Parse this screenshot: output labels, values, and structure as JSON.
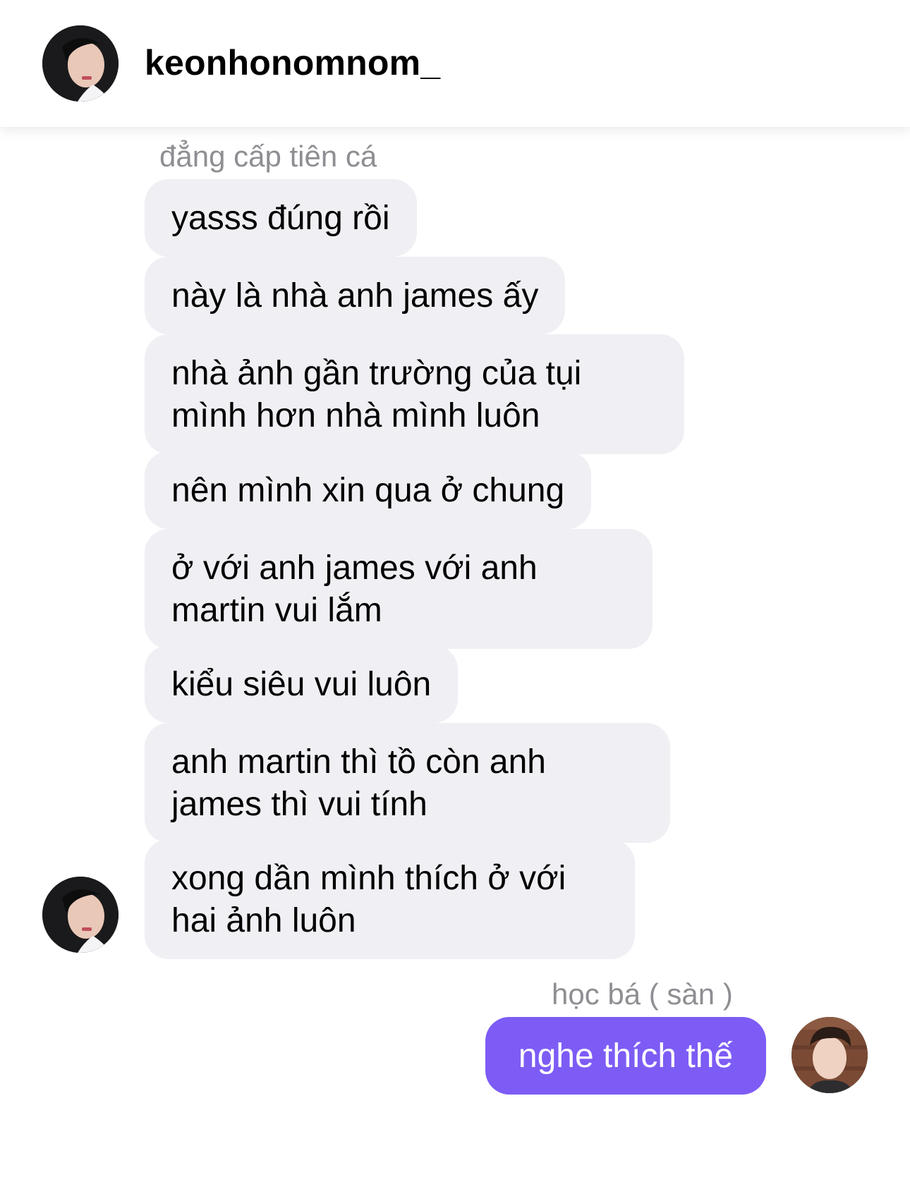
{
  "header": {
    "username": "keonhonomnom_",
    "avatar_icon": "profile-photo-avatar"
  },
  "incoming": {
    "sender_label": "đẳng cấp tiên cá",
    "messages": [
      "yasss đúng rồi",
      "này là nhà anh james ấy",
      "nhà ảnh gần trường của tụi mình hơn nhà mình luôn",
      "nên mình xin qua ở chung",
      "ở với anh james với anh martin vui lắm",
      "kiểu siêu vui luôn",
      "anh martin thì tồ còn anh james thì vui tính",
      "xong dần mình thích ở với hai ảnh luôn"
    ]
  },
  "outgoing": {
    "sender_label": "học bá ( sàn )",
    "messages": [
      "nghe thích thế"
    ]
  },
  "colors": {
    "incoming_bubble": "#efeff4",
    "outgoing_bubble": "#7d5cf5",
    "label_gray": "#8e8e93"
  }
}
